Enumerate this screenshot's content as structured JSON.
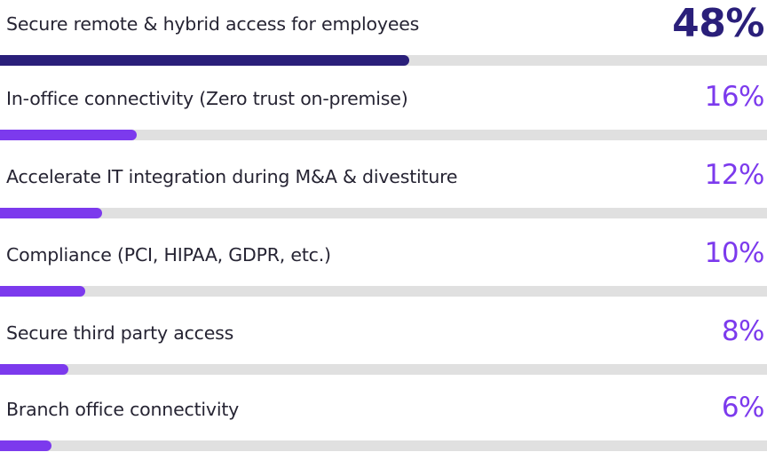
{
  "chart_data": {
    "type": "bar",
    "orientation": "horizontal",
    "categories": [
      "Secure remote & hybrid access for employees",
      "In-office connectivity (Zero trust on-premise)",
      "Accelerate IT integration during M&A & divestiture",
      "Compliance (PCI, HIPAA, GDPR, etc.)",
      "Secure third party access",
      "Branch office connectivity"
    ],
    "values": [
      48,
      16,
      12,
      10,
      8,
      6
    ],
    "value_labels": [
      "48%",
      "16%",
      "12%",
      "10%",
      "8%",
      "6%"
    ],
    "unit": "%",
    "xlim": [
      0,
      90
    ],
    "title": "",
    "xlabel": "",
    "ylabel": "",
    "grid": false,
    "legend": "none"
  },
  "colors": {
    "highlight": "#2a1f7a",
    "accent": "#7c3aed",
    "track": "#e0e0e0",
    "label_text": "#262433"
  }
}
